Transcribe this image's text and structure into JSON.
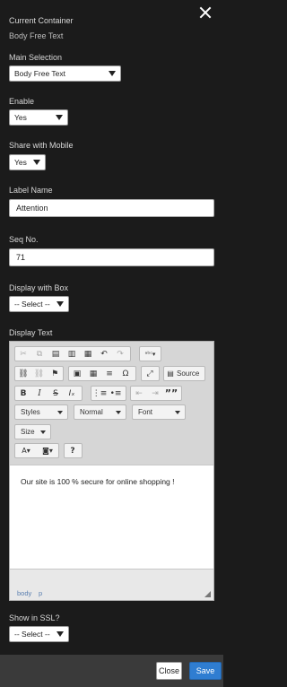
{
  "container": {
    "heading": "Current Container",
    "name": "Body Free Text"
  },
  "main_selection": {
    "label": "Main Selection",
    "value": "Body Free Text"
  },
  "enable": {
    "label": "Enable",
    "value": "Yes"
  },
  "share_mobile": {
    "label": "Share with Mobile",
    "value": "Yes"
  },
  "label_name": {
    "label": "Label Name",
    "value": "Attention"
  },
  "seq_no": {
    "label": "Seq No.",
    "value": "71"
  },
  "display_box": {
    "label": "Display with Box",
    "value": "-- Select --"
  },
  "display_text": {
    "label": "Display Text",
    "toolbar": {
      "source": "Source",
      "styles": "Styles",
      "format": "Normal",
      "font": "Font",
      "size": "Size",
      "quote": "””",
      "help": "?"
    },
    "content": "Our site is 100 % secure for online shopping !",
    "path": [
      "body",
      "p"
    ]
  },
  "ssl": {
    "label": "Show in SSL?",
    "value": "-- Select --"
  },
  "footer": {
    "close": "Close",
    "save": "Save"
  }
}
